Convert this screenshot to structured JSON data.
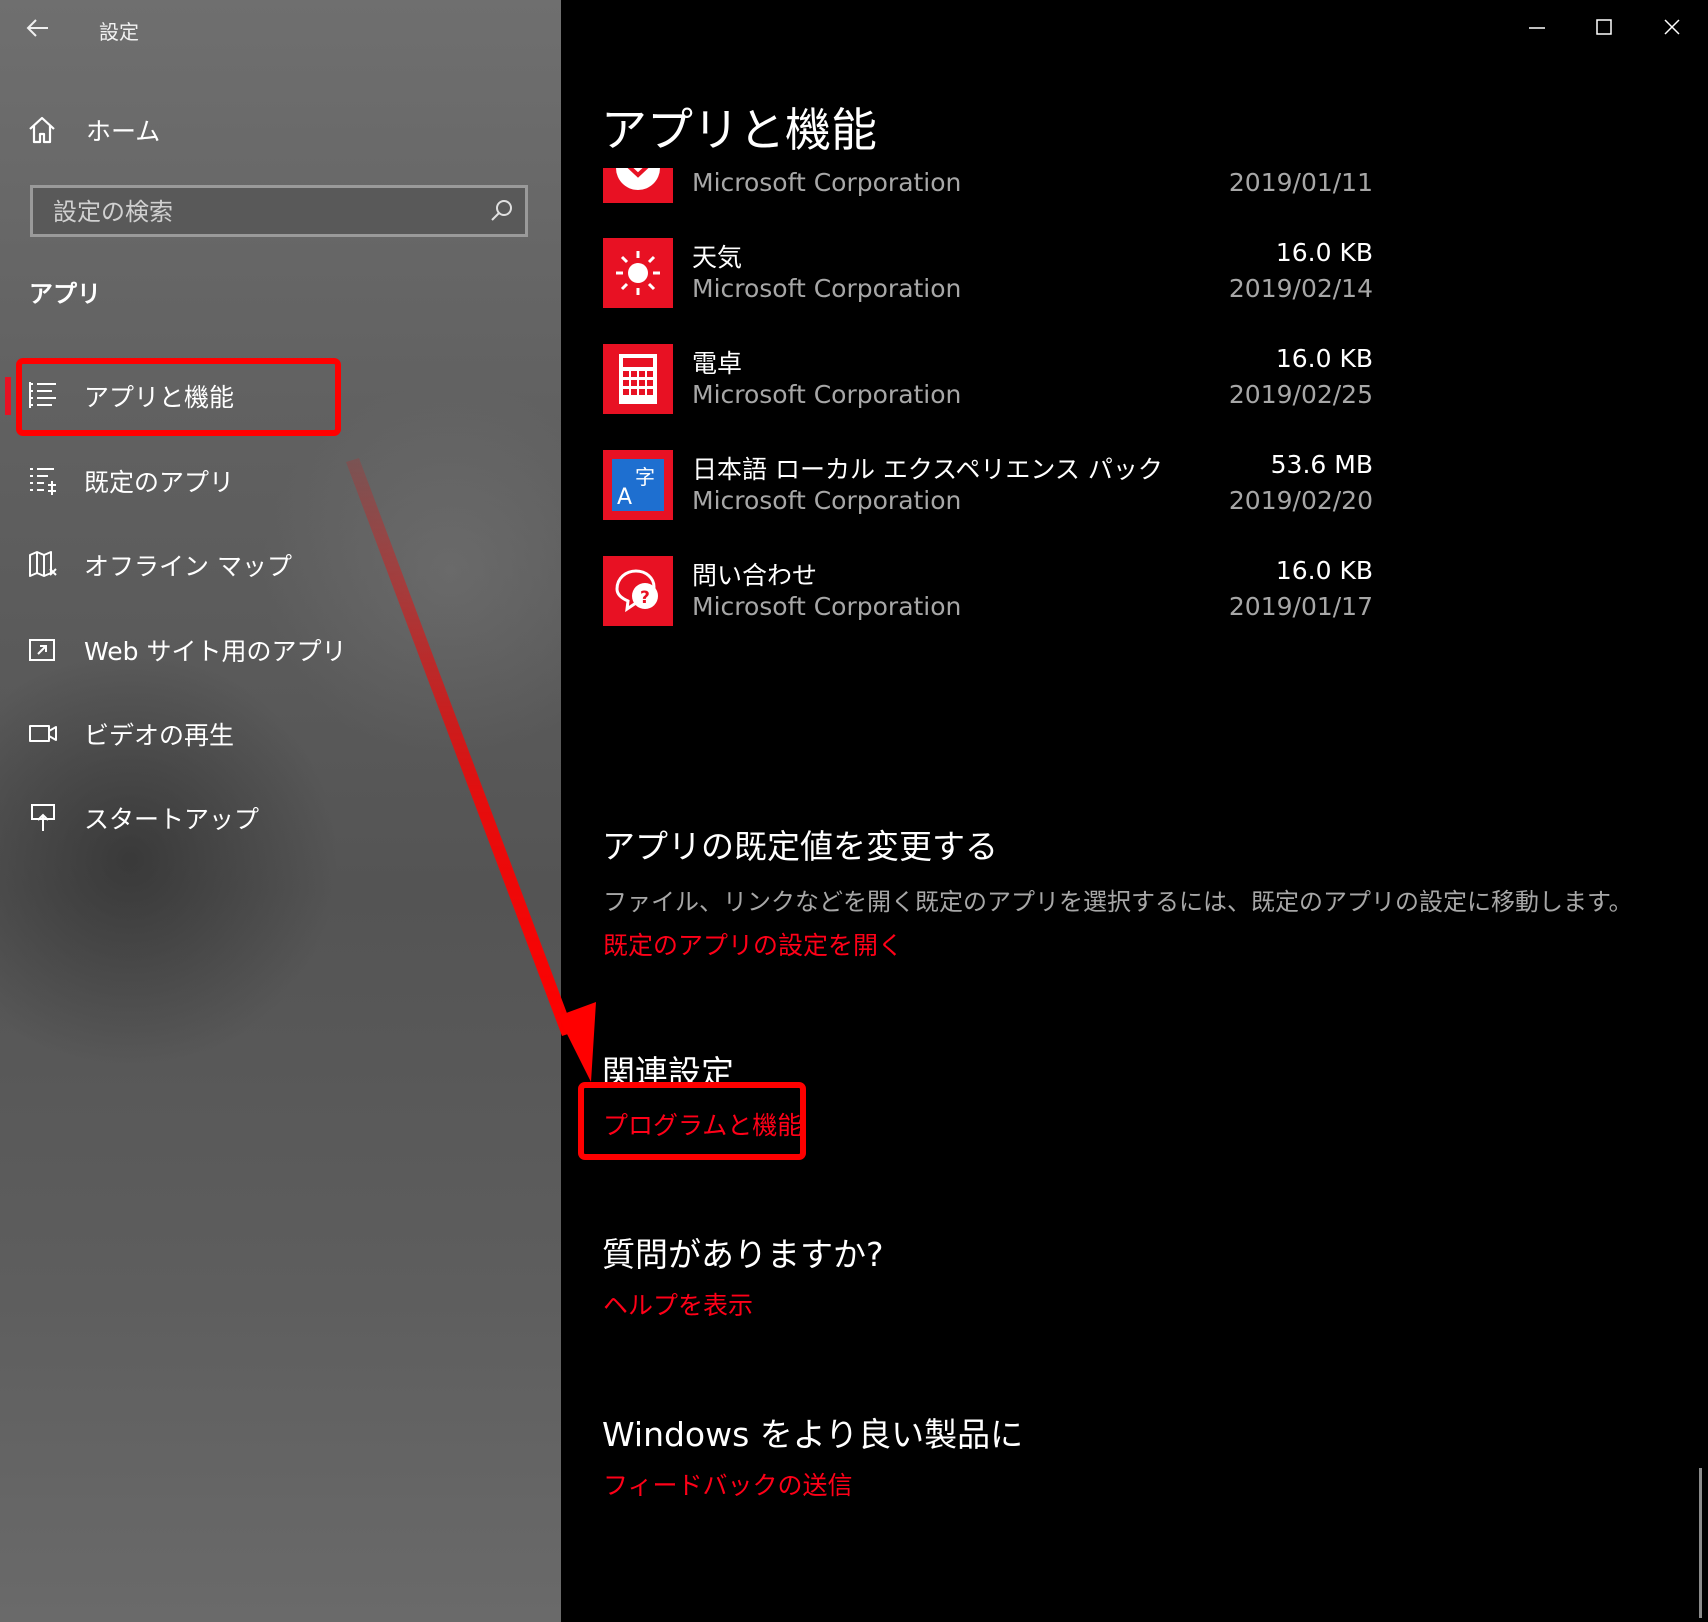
{
  "window": {
    "title": "設定",
    "controls": [
      "minimize",
      "maximize",
      "close"
    ]
  },
  "sidebar": {
    "home_label": "ホーム",
    "search_placeholder": "設定の検索",
    "section_title": "アプリ",
    "items": [
      {
        "label": "アプリと機能",
        "icon": "apps-features-icon",
        "active": true
      },
      {
        "label": "既定のアプリ",
        "icon": "default-apps-icon",
        "active": false
      },
      {
        "label": "オフライン マップ",
        "icon": "offline-maps-icon",
        "active": false
      },
      {
        "label": "Web サイト用のアプリ",
        "icon": "apps-for-websites-icon",
        "active": false
      },
      {
        "label": "ビデオの再生",
        "icon": "video-playback-icon",
        "active": false
      },
      {
        "label": "スタートアップ",
        "icon": "startup-icon",
        "active": false
      }
    ]
  },
  "main": {
    "title": "アプリと機能",
    "apps": [
      {
        "name": "",
        "publisher": "Microsoft Corporation",
        "size": "",
        "date": "2019/01/11",
        "icon": "partial-app-icon"
      },
      {
        "name": "天気",
        "publisher": "Microsoft Corporation",
        "size": "16.0 KB",
        "date": "2019/02/14",
        "icon": "weather-sun-icon"
      },
      {
        "name": "電卓",
        "publisher": "Microsoft Corporation",
        "size": "16.0 KB",
        "date": "2019/02/25",
        "icon": "calculator-icon"
      },
      {
        "name": "日本語 ローカル エクスペリエンス パック",
        "publisher": "Microsoft Corporation",
        "size": "53.6 MB",
        "date": "2019/02/20",
        "icon": "language-pack-icon"
      },
      {
        "name": "問い合わせ",
        "publisher": "Microsoft Corporation",
        "size": "16.0 KB",
        "date": "2019/01/17",
        "icon": "contact-support-icon"
      }
    ],
    "default_section": {
      "heading": "アプリの既定値を変更する",
      "description": "ファイル、リンクなどを開く既定のアプリを選択するには、既定のアプリの設定に移動します。",
      "link": "既定のアプリの設定を開く"
    },
    "related_section": {
      "heading": "関連設定",
      "link": "プログラムと機能"
    },
    "help_section": {
      "heading": "質問がありますか?",
      "link": "ヘルプを表示"
    },
    "feedback_section": {
      "heading": "Windows をより良い製品に",
      "link": "フィードバックの送信"
    }
  },
  "colors": {
    "accent": "#e81123",
    "link": "#ff0018",
    "annotation": "#ff0000",
    "main_bg": "#000000"
  }
}
